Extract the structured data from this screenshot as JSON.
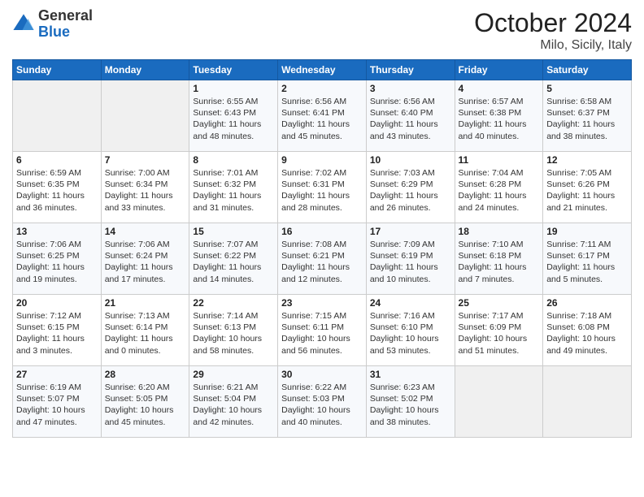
{
  "header": {
    "logo_line1": "General",
    "logo_line2": "Blue",
    "title": "October 2024",
    "subtitle": "Milo, Sicily, Italy"
  },
  "weekdays": [
    "Sunday",
    "Monday",
    "Tuesday",
    "Wednesday",
    "Thursday",
    "Friday",
    "Saturday"
  ],
  "weeks": [
    [
      {
        "day": "",
        "info": ""
      },
      {
        "day": "",
        "info": ""
      },
      {
        "day": "1",
        "info": "Sunrise: 6:55 AM\nSunset: 6:43 PM\nDaylight: 11 hours and 48 minutes."
      },
      {
        "day": "2",
        "info": "Sunrise: 6:56 AM\nSunset: 6:41 PM\nDaylight: 11 hours and 45 minutes."
      },
      {
        "day": "3",
        "info": "Sunrise: 6:56 AM\nSunset: 6:40 PM\nDaylight: 11 hours and 43 minutes."
      },
      {
        "day": "4",
        "info": "Sunrise: 6:57 AM\nSunset: 6:38 PM\nDaylight: 11 hours and 40 minutes."
      },
      {
        "day": "5",
        "info": "Sunrise: 6:58 AM\nSunset: 6:37 PM\nDaylight: 11 hours and 38 minutes."
      }
    ],
    [
      {
        "day": "6",
        "info": "Sunrise: 6:59 AM\nSunset: 6:35 PM\nDaylight: 11 hours and 36 minutes."
      },
      {
        "day": "7",
        "info": "Sunrise: 7:00 AM\nSunset: 6:34 PM\nDaylight: 11 hours and 33 minutes."
      },
      {
        "day": "8",
        "info": "Sunrise: 7:01 AM\nSunset: 6:32 PM\nDaylight: 11 hours and 31 minutes."
      },
      {
        "day": "9",
        "info": "Sunrise: 7:02 AM\nSunset: 6:31 PM\nDaylight: 11 hours and 28 minutes."
      },
      {
        "day": "10",
        "info": "Sunrise: 7:03 AM\nSunset: 6:29 PM\nDaylight: 11 hours and 26 minutes."
      },
      {
        "day": "11",
        "info": "Sunrise: 7:04 AM\nSunset: 6:28 PM\nDaylight: 11 hours and 24 minutes."
      },
      {
        "day": "12",
        "info": "Sunrise: 7:05 AM\nSunset: 6:26 PM\nDaylight: 11 hours and 21 minutes."
      }
    ],
    [
      {
        "day": "13",
        "info": "Sunrise: 7:06 AM\nSunset: 6:25 PM\nDaylight: 11 hours and 19 minutes."
      },
      {
        "day": "14",
        "info": "Sunrise: 7:06 AM\nSunset: 6:24 PM\nDaylight: 11 hours and 17 minutes."
      },
      {
        "day": "15",
        "info": "Sunrise: 7:07 AM\nSunset: 6:22 PM\nDaylight: 11 hours and 14 minutes."
      },
      {
        "day": "16",
        "info": "Sunrise: 7:08 AM\nSunset: 6:21 PM\nDaylight: 11 hours and 12 minutes."
      },
      {
        "day": "17",
        "info": "Sunrise: 7:09 AM\nSunset: 6:19 PM\nDaylight: 11 hours and 10 minutes."
      },
      {
        "day": "18",
        "info": "Sunrise: 7:10 AM\nSunset: 6:18 PM\nDaylight: 11 hours and 7 minutes."
      },
      {
        "day": "19",
        "info": "Sunrise: 7:11 AM\nSunset: 6:17 PM\nDaylight: 11 hours and 5 minutes."
      }
    ],
    [
      {
        "day": "20",
        "info": "Sunrise: 7:12 AM\nSunset: 6:15 PM\nDaylight: 11 hours and 3 minutes."
      },
      {
        "day": "21",
        "info": "Sunrise: 7:13 AM\nSunset: 6:14 PM\nDaylight: 11 hours and 0 minutes."
      },
      {
        "day": "22",
        "info": "Sunrise: 7:14 AM\nSunset: 6:13 PM\nDaylight: 10 hours and 58 minutes."
      },
      {
        "day": "23",
        "info": "Sunrise: 7:15 AM\nSunset: 6:11 PM\nDaylight: 10 hours and 56 minutes."
      },
      {
        "day": "24",
        "info": "Sunrise: 7:16 AM\nSunset: 6:10 PM\nDaylight: 10 hours and 53 minutes."
      },
      {
        "day": "25",
        "info": "Sunrise: 7:17 AM\nSunset: 6:09 PM\nDaylight: 10 hours and 51 minutes."
      },
      {
        "day": "26",
        "info": "Sunrise: 7:18 AM\nSunset: 6:08 PM\nDaylight: 10 hours and 49 minutes."
      }
    ],
    [
      {
        "day": "27",
        "info": "Sunrise: 6:19 AM\nSunset: 5:07 PM\nDaylight: 10 hours and 47 minutes."
      },
      {
        "day": "28",
        "info": "Sunrise: 6:20 AM\nSunset: 5:05 PM\nDaylight: 10 hours and 45 minutes."
      },
      {
        "day": "29",
        "info": "Sunrise: 6:21 AM\nSunset: 5:04 PM\nDaylight: 10 hours and 42 minutes."
      },
      {
        "day": "30",
        "info": "Sunrise: 6:22 AM\nSunset: 5:03 PM\nDaylight: 10 hours and 40 minutes."
      },
      {
        "day": "31",
        "info": "Sunrise: 6:23 AM\nSunset: 5:02 PM\nDaylight: 10 hours and 38 minutes."
      },
      {
        "day": "",
        "info": ""
      },
      {
        "day": "",
        "info": ""
      }
    ]
  ]
}
